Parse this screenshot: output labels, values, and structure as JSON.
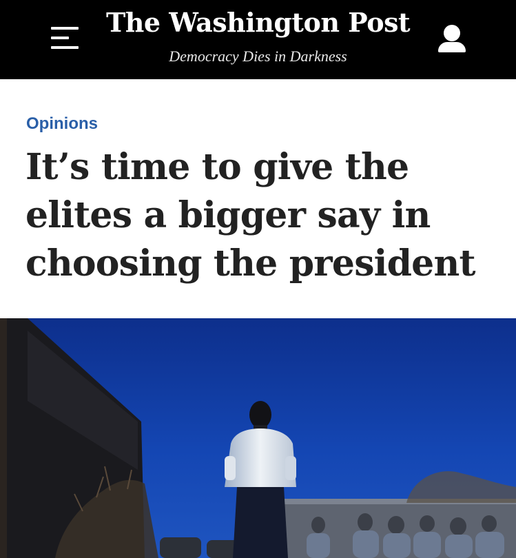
{
  "header": {
    "masthead": "The Washington Post",
    "tagline": "Democracy Dies in Darkness",
    "menu_icon": "hamburger-menu-icon",
    "account_icon": "user-account-icon"
  },
  "article": {
    "section": "Opinions",
    "headline": "It’s time to give the elites a bigger say in choosing the president"
  },
  "colors": {
    "header_bg": "#000000",
    "section_link": "#2a5fa8",
    "headline_text": "#222222"
  }
}
